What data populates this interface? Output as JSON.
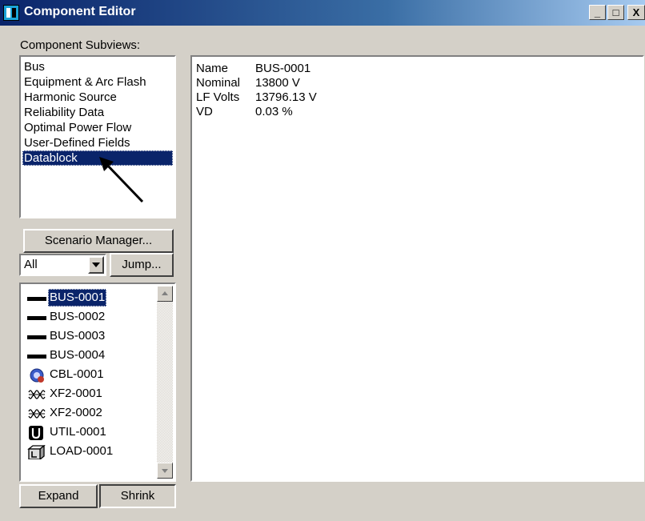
{
  "window": {
    "title": "Component Editor"
  },
  "controls": {
    "minimize": "_",
    "maximize": "□",
    "close": "X"
  },
  "subviews": {
    "label": "Component Subviews:",
    "items": [
      {
        "label": "Bus"
      },
      {
        "label": "Equipment & Arc Flash"
      },
      {
        "label": "Harmonic Source"
      },
      {
        "label": "Reliability Data"
      },
      {
        "label": "Optimal Power Flow"
      },
      {
        "label": "User-Defined Fields"
      },
      {
        "label": "Datablock"
      }
    ],
    "selected_index": 6
  },
  "buttons": {
    "scenario_manager": "Scenario Manager...",
    "jump": "Jump...",
    "expand": "Expand",
    "shrink": "Shrink"
  },
  "filter": {
    "selected": "All"
  },
  "components": {
    "items": [
      {
        "label": "BUS-0001",
        "icon": "bus-icon"
      },
      {
        "label": "BUS-0002",
        "icon": "bus-icon"
      },
      {
        "label": "BUS-0003",
        "icon": "bus-icon"
      },
      {
        "label": "BUS-0004",
        "icon": "bus-icon"
      },
      {
        "label": "CBL-0001",
        "icon": "cable-icon"
      },
      {
        "label": "XF2-0001",
        "icon": "transformer-icon"
      },
      {
        "label": "XF2-0002",
        "icon": "transformer-icon"
      },
      {
        "label": "UTIL-0001",
        "icon": "utility-icon"
      },
      {
        "label": "LOAD-0001",
        "icon": "load-icon"
      }
    ],
    "selected_index": 0
  },
  "datablock": {
    "rows": [
      {
        "key": "Name",
        "value": "BUS-0001"
      },
      {
        "key": "Nominal",
        "value": "13800 V"
      },
      {
        "key": "LF Volts",
        "value": "13796.13 V"
      },
      {
        "key": "VD",
        "value": "0.03 %"
      }
    ]
  },
  "colors": {
    "selection": "#0a246a",
    "face": "#d4d0c8",
    "titlebar": "#0a246a"
  }
}
